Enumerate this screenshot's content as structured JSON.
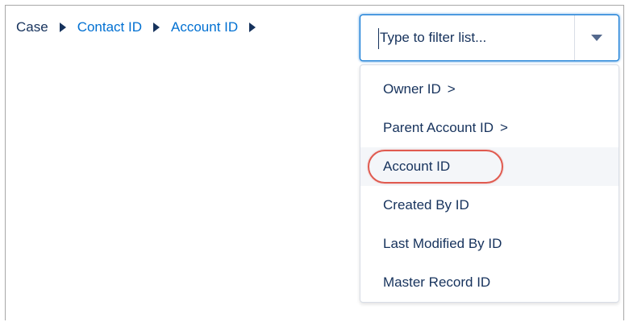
{
  "breadcrumb": {
    "root": "Case",
    "links": [
      "Contact ID",
      "Account ID"
    ]
  },
  "combobox": {
    "placeholder": "Type to filter list...",
    "dropdown_icon": "chevron-down-icon"
  },
  "options": [
    {
      "label": "Owner ID",
      "chevron": ">"
    },
    {
      "label": "Parent Account ID",
      "chevron": ">"
    },
    {
      "label": "Account ID",
      "chevron": ""
    },
    {
      "label": "Created By ID",
      "chevron": ""
    },
    {
      "label": "Last Modified By ID",
      "chevron": ""
    },
    {
      "label": "Master Record ID",
      "chevron": ""
    }
  ],
  "colors": {
    "link": "#0070d2",
    "text": "#16325c",
    "highlight_oval": "#e05a4f",
    "hover_row": "#f4f6f9"
  }
}
